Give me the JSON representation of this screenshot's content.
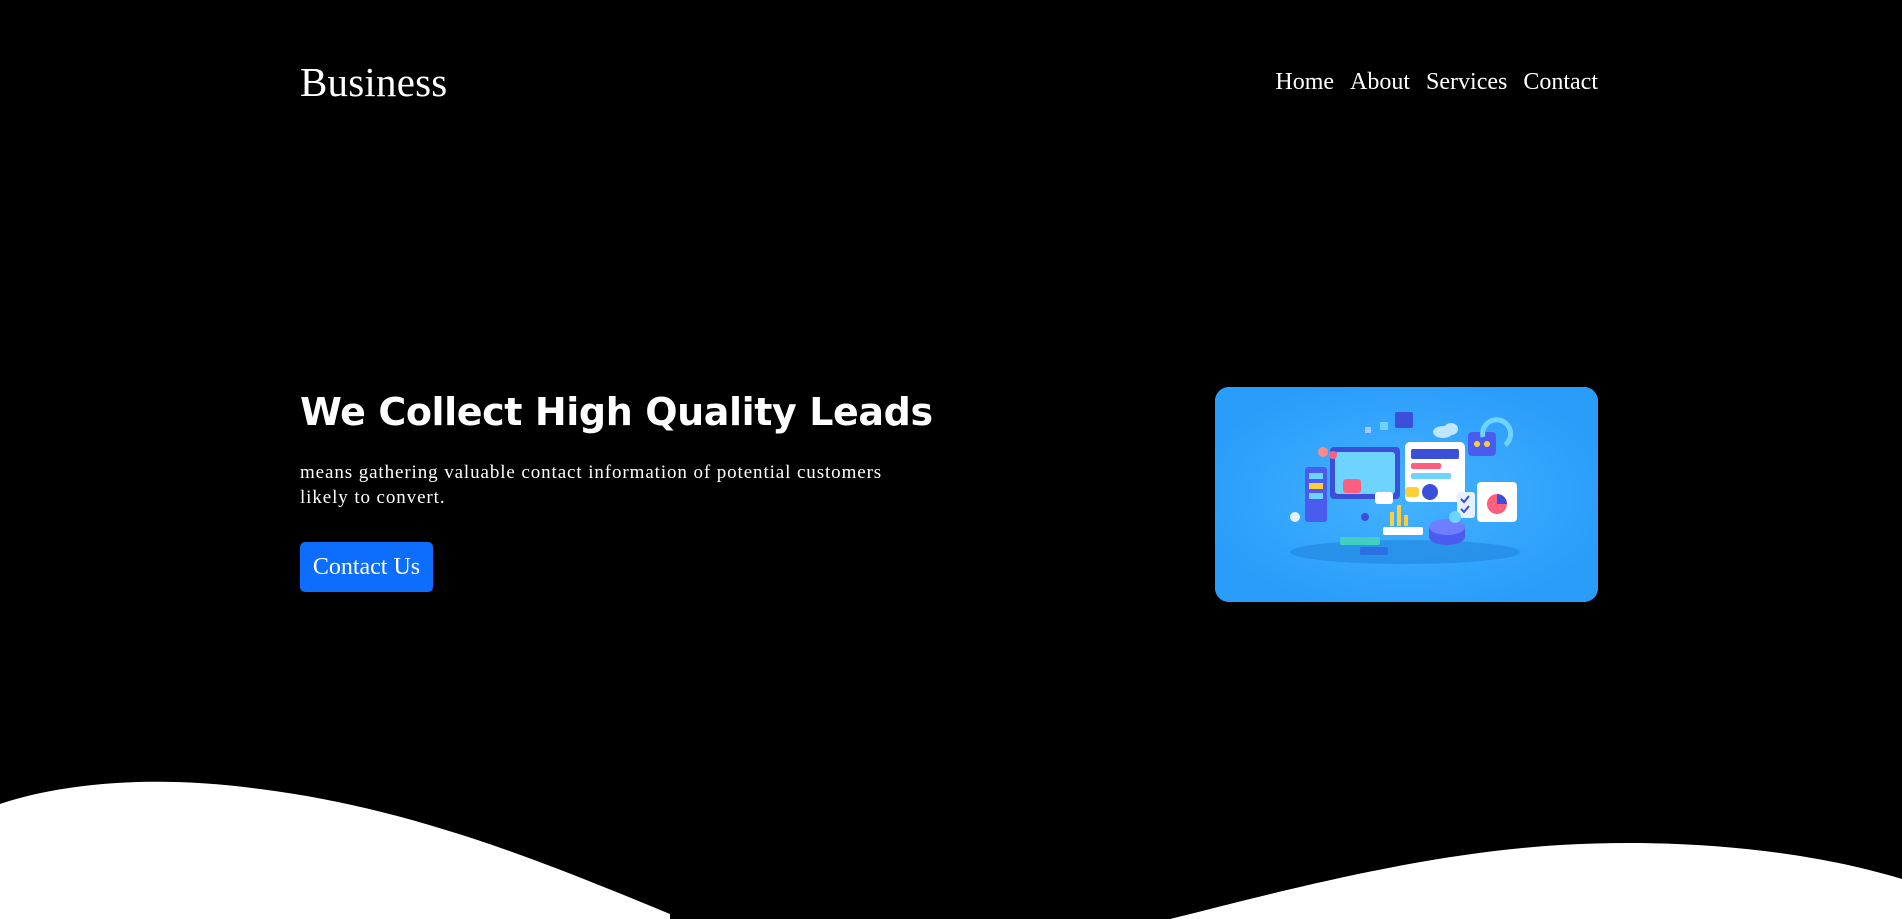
{
  "brand": {
    "name": "Business"
  },
  "nav": {
    "items": [
      {
        "label": "Home"
      },
      {
        "label": "About"
      },
      {
        "label": "Services"
      },
      {
        "label": "Contact"
      }
    ]
  },
  "hero": {
    "title": "We Collect High Quality Leads",
    "description": "means gathering valuable contact information of potential customers likely to convert.",
    "cta_label": "Contact Us",
    "illustration_icon": "lead-generation-dashboard-illustration"
  },
  "colors": {
    "background": "#000000",
    "text": "#ffffff",
    "accent": "#0d6efd",
    "illustration_bg": "#2a9dfa",
    "wave": "#ffffff"
  }
}
